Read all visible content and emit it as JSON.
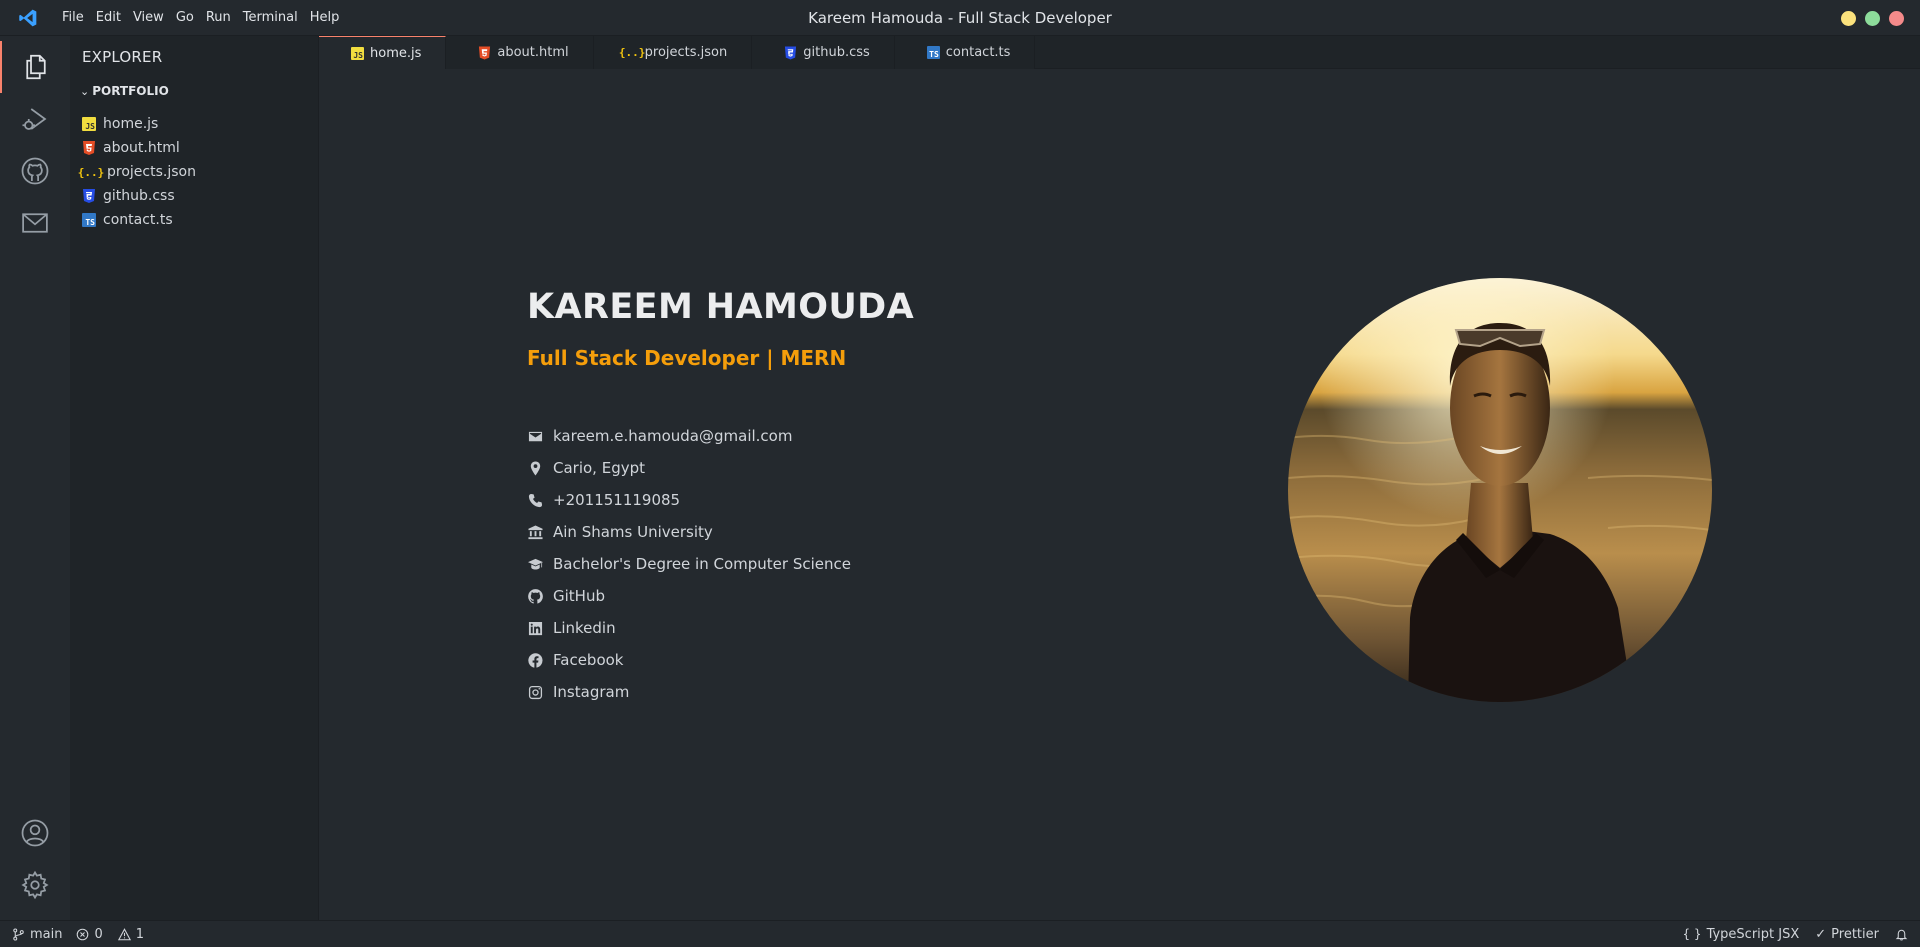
{
  "window": {
    "title": "Kareem Hamouda - Full Stack Developer",
    "app_icon": "vscode-icon"
  },
  "menu": [
    "File",
    "Edit",
    "View",
    "Go",
    "Run",
    "Terminal",
    "Help"
  ],
  "activity_bar": {
    "top": [
      "files-icon",
      "run-debug-icon",
      "github-icon",
      "mail-icon"
    ],
    "bottom": [
      "account-icon",
      "settings-gear-icon"
    ]
  },
  "sidebar": {
    "title": "EXPLORER",
    "folder": "PORTFOLIO",
    "files": [
      {
        "name": "home.js",
        "type": "js"
      },
      {
        "name": "about.html",
        "type": "html"
      },
      {
        "name": "projects.json",
        "type": "json"
      },
      {
        "name": "github.css",
        "type": "css"
      },
      {
        "name": "contact.ts",
        "type": "ts"
      }
    ]
  },
  "tabs": [
    {
      "label": "home.js",
      "type": "js",
      "active": true
    },
    {
      "label": "about.html",
      "type": "html",
      "active": false
    },
    {
      "label": "projects.json",
      "type": "json",
      "active": false
    },
    {
      "label": "github.css",
      "type": "css",
      "active": false
    },
    {
      "label": "contact.ts",
      "type": "ts",
      "active": false
    }
  ],
  "profile": {
    "name": "KAREEM HAMOUDA",
    "role": "Full Stack Developer | MERN",
    "info": [
      {
        "icon": "envelope-icon",
        "text": "kareem.e.hamouda@gmail.com"
      },
      {
        "icon": "location-pin-icon",
        "text": "Cario, Egypt"
      },
      {
        "icon": "phone-icon",
        "text": "+201151119085"
      },
      {
        "icon": "university-icon",
        "text": "Ain Shams University"
      },
      {
        "icon": "graduation-cap-icon",
        "text": "Bachelor's Degree in Computer Science"
      },
      {
        "icon": "github-icon",
        "text": "GitHub"
      },
      {
        "icon": "linkedin-icon",
        "text": "Linkedin"
      },
      {
        "icon": "facebook-icon",
        "text": "Facebook"
      },
      {
        "icon": "instagram-icon",
        "text": "Instagram"
      }
    ]
  },
  "statusbar": {
    "branch": "main",
    "errors": "0",
    "warnings": "1",
    "language": "TypeScript JSX",
    "formatter": "Prettier"
  },
  "colors": {
    "accent": "#f59e0b",
    "background": "#24292e",
    "sidebar": "#1f2428",
    "active_tab_border": "#f9826c"
  }
}
